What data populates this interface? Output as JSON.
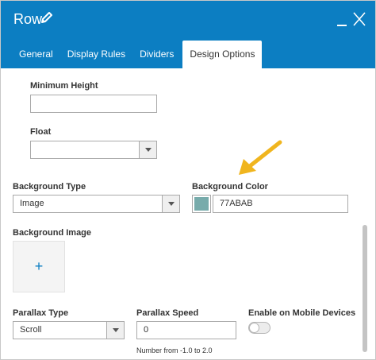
{
  "header": {
    "title": "Row",
    "tabs": [
      {
        "label": "General"
      },
      {
        "label": "Display Rules"
      },
      {
        "label": "Dividers"
      },
      {
        "label": "Design Options"
      }
    ]
  },
  "form": {
    "min_height": {
      "label": "Minimum Height",
      "value": ""
    },
    "float": {
      "label": "Float",
      "value": ""
    },
    "background_type": {
      "label": "Background Type",
      "value": "Image"
    },
    "background_color": {
      "label": "Background Color",
      "value": "77ABAB",
      "swatch": "#77abab"
    },
    "background_image": {
      "label": "Background Image",
      "add": "+"
    },
    "parallax_type": {
      "label": "Parallax Type",
      "value": "Scroll"
    },
    "parallax_speed": {
      "label": "Parallax Speed",
      "value": "0",
      "hint": "Number from -1.0 to 2.0"
    },
    "mobile": {
      "label": "Enable on Mobile Devices",
      "enabled": false
    }
  },
  "colors": {
    "header": "#0c7ec2",
    "arrow": "#f0b51e"
  }
}
